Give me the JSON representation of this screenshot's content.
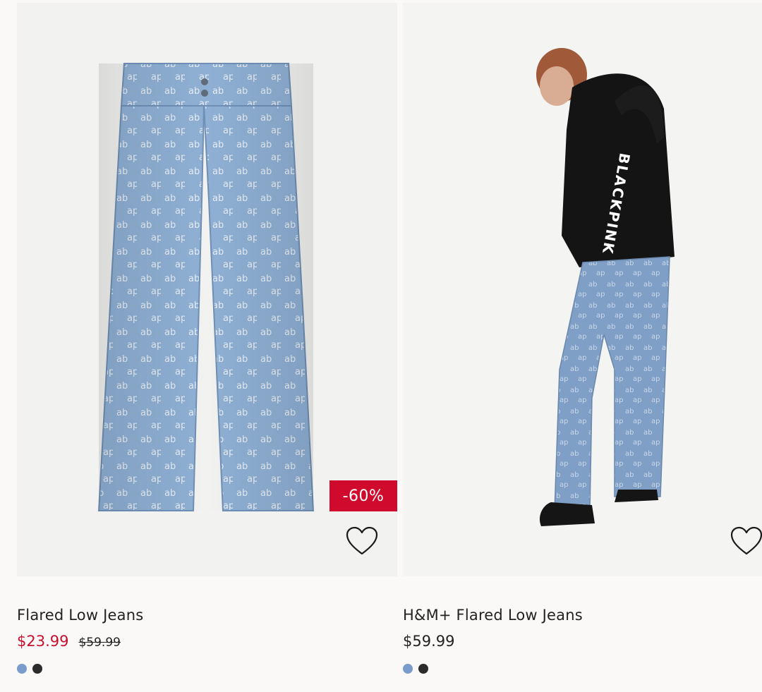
{
  "products": [
    {
      "title": "Flared Low Jeans",
      "price_sale": "$23.99",
      "price_original": "$59.99",
      "discount": "-60%",
      "favorite_icon": "heart-outline-icon",
      "swatches": [
        "#7a9ccc",
        "#2b2b2b"
      ]
    },
    {
      "title": "H&M+ Flared Low Jeans",
      "price": "$59.99",
      "favorite_icon": "heart-outline-icon",
      "swatches": [
        "#7a9ccc",
        "#2b2b2b"
      ]
    }
  ],
  "colors": {
    "sale_price": "#c8102e",
    "discount_badge": "#cf0a2c",
    "background": "#faf9f8"
  }
}
